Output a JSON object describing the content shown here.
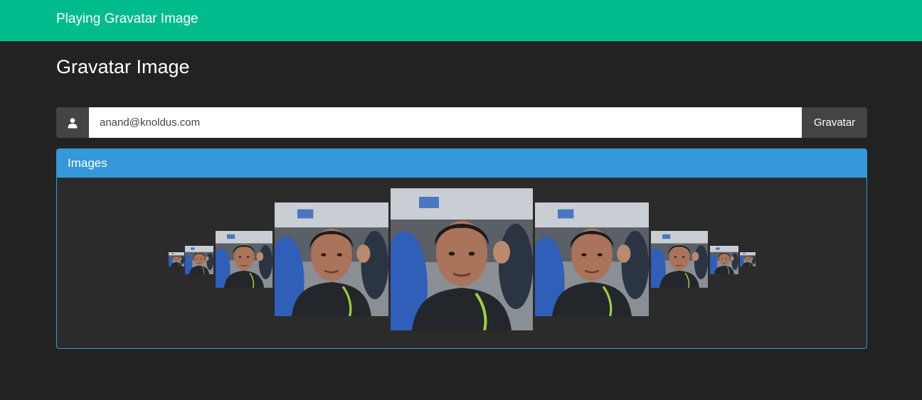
{
  "navbar": {
    "brand": "Playing Gravatar Image"
  },
  "page": {
    "title": "Gravatar Image"
  },
  "search": {
    "icon": "user-icon",
    "email_value": "anand@knoldus.com",
    "button_label": "Gravatar"
  },
  "panel": {
    "heading": "Images",
    "images": [
      {
        "name": "avatar-image-1"
      },
      {
        "name": "avatar-image-2"
      },
      {
        "name": "avatar-image-3"
      },
      {
        "name": "avatar-image-4"
      },
      {
        "name": "avatar-image-5"
      },
      {
        "name": "avatar-image-6"
      },
      {
        "name": "avatar-image-7"
      },
      {
        "name": "avatar-image-8"
      },
      {
        "name": "avatar-image-9"
      }
    ]
  },
  "colors": {
    "navbar": "#00bc8c",
    "background": "#222222",
    "panel_accent": "#3498db",
    "addon": "#444444"
  }
}
